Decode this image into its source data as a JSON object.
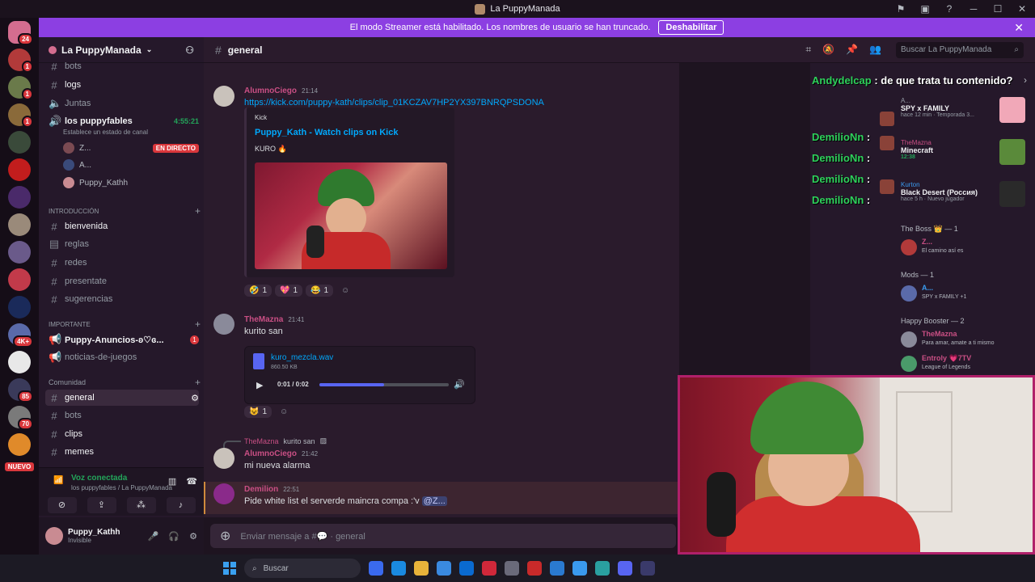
{
  "window": {
    "title": "La PuppyManada"
  },
  "banner": {
    "text": "El modo Streamer está habilitado. Los nombres de usuario se han truncado.",
    "button": "Deshabilitar"
  },
  "servers": {
    "badges": [
      "24",
      "1",
      "1",
      "1",
      "4K+",
      "85",
      "70"
    ],
    "new_label": "NUEVO"
  },
  "guild": {
    "name": "La PuppyManada"
  },
  "sidebar": {
    "top_channels": [
      "bots",
      "logs",
      "Juntas"
    ],
    "voice_channel": "los puppyfables",
    "voice_timer": "4:55:21",
    "voice_status_hint": "Establece un estado de canal",
    "voice_users": [
      {
        "name": "Z...",
        "tag": "EN DIRECTO"
      },
      {
        "name": "A..."
      },
      {
        "name": "Puppy_Kathh"
      }
    ],
    "categories": [
      {
        "name": "INTRODUCCIÓN",
        "channels": [
          "bienvenida",
          "reglas",
          "redes",
          "presentate",
          "sugerencias"
        ]
      },
      {
        "name": "IMPORTANTE",
        "channels": [
          {
            "name": "Puppy-Anuncios-ʚ♡ɞ...",
            "unread": "1"
          },
          {
            "name": "noticias-de-juegos"
          }
        ]
      },
      {
        "name": "Comunidad",
        "channels": [
          "general",
          "bots",
          "clips",
          "memes"
        ]
      }
    ]
  },
  "voice_panel": {
    "title": "Voz conectada",
    "subtitle": "los puppyfables / La PuppyManada"
  },
  "user_panel": {
    "name": "Puppy_Kathh",
    "status": "Invisible"
  },
  "header": {
    "channel": "general",
    "search_placeholder": "Buscar La PuppyManada"
  },
  "messages": [
    {
      "author": "AlumnoCiego",
      "time": "21:14",
      "text": "https://kick.com/puppy-kath/clips/clip_01KCZAV7HP2YX397BNRQPSDONA",
      "embed": {
        "provider": "Kick",
        "title": "Puppy_Kath - Watch clips on Kick",
        "description": "KURO 🔥"
      },
      "reactions": [
        {
          "emoji": "🤣",
          "count": "1"
        },
        {
          "emoji": "💖",
          "count": "1"
        },
        {
          "emoji": "😂",
          "count": "1"
        }
      ]
    },
    {
      "author": "TheMazna",
      "time": "21:41",
      "text": "kurito san",
      "file": {
        "name": "kuro_mezcla.wav",
        "size": "860.50 KB",
        "time": "0:01 / 0:02",
        "progress": 0.5
      },
      "reactions": [
        {
          "emoji": "😺",
          "count": "1"
        }
      ]
    },
    {
      "reply_author": "TheMazna",
      "reply_text": "kurito san",
      "author": "AlumnoCiego",
      "time": "21:42",
      "text": "mi nueva alarma"
    },
    {
      "author": "Demilion",
      "time": "22:51",
      "text": "Pide white list el serverde maincra compa :'v",
      "mention": "@Z..."
    }
  ],
  "composer": {
    "placeholder": "Enviar mensaje a #",
    "channel": "general"
  },
  "overlay_chat": [
    {
      "user": "Andydelcap",
      "text": ": de que trata tu contenido?"
    },
    {
      "user": "DemilioNn",
      "text": ":"
    },
    {
      "user": "DemilioNn",
      "text": ":"
    },
    {
      "user": "DemilioNn",
      "text": ":"
    },
    {
      "user": "DemilioNn",
      "text": ":"
    },
    {
      "user": "DemilioNn",
      "text": ":"
    }
  ],
  "activities": [
    {
      "name": "A...",
      "title": "SPY x FAMILY",
      "sub": "hace 12 min · Temporada 3..."
    },
    {
      "name": "TheMazna",
      "title": "Minecraft",
      "sub": "12:38"
    },
    {
      "name": "Kurton",
      "title": "Black Desert (Россия)",
      "sub": "hace 5 h · Nuevo jugador"
    }
  ],
  "members": {
    "groups": [
      {
        "label": "The Boss 👑 — 1",
        "members": [
          {
            "name": "Z...",
            "status": "El camino así es"
          }
        ]
      },
      {
        "label": "Mods — 1",
        "members": [
          {
            "name": "A...",
            "status": "SPY x FAMILY +1"
          }
        ]
      },
      {
        "label": "Happy Booster — 2",
        "members": [
          {
            "name": "TheMazna",
            "status": "Para amar, amate a ti mismo"
          },
          {
            "name": "Entroly 💗7TV",
            "status": "League of Legends"
          }
        ]
      }
    ]
  },
  "taskbar": {
    "search_placeholder": "Buscar"
  },
  "colors": {
    "accent": "#8c3fe2",
    "online": "#23a55a",
    "link": "#00a8fc",
    "live": "#da373c"
  }
}
